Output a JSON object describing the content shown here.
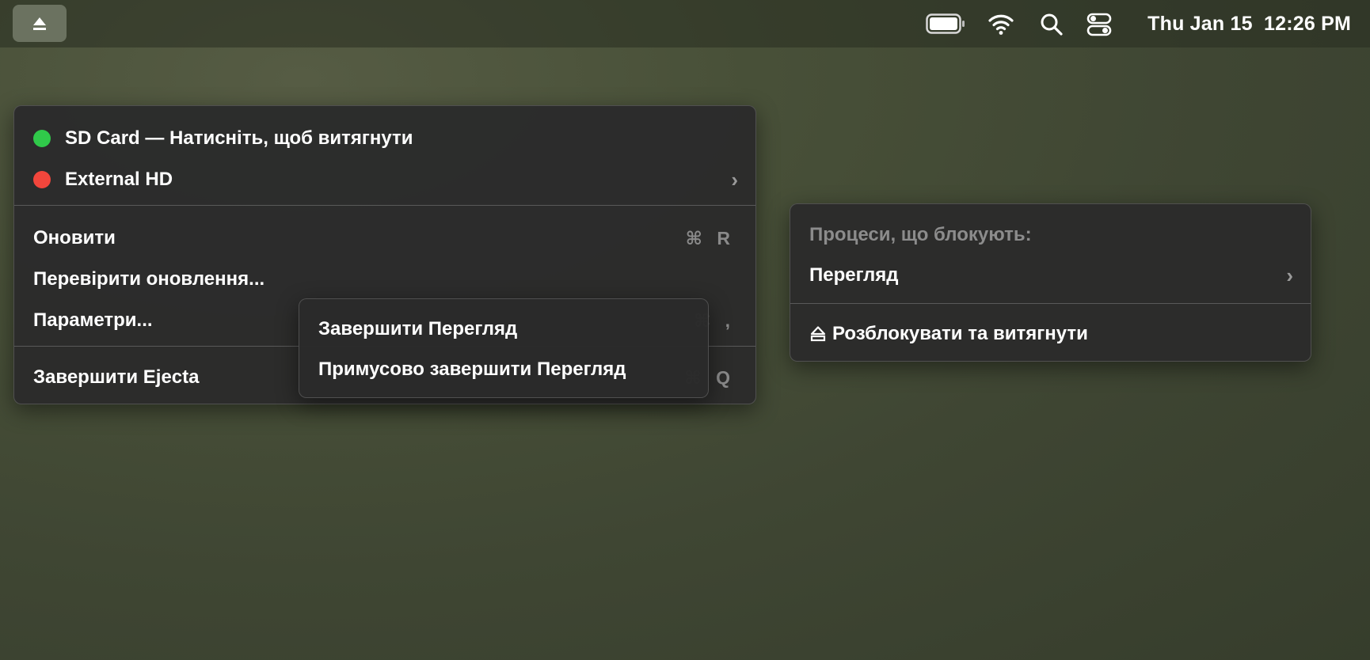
{
  "menubar": {
    "clock": "Thu Jan 15  12:26 PM",
    "icons": [
      "eject-icon",
      "battery-icon",
      "wifi-icon",
      "search-icon",
      "control-center-icon"
    ]
  },
  "main_menu": {
    "drives": [
      {
        "label": "SD Card — Натисніть, щоб витягнути",
        "status_color": "#30c94a"
      },
      {
        "label": "External HD",
        "status_color": "#f2463c",
        "has_submenu": true
      }
    ],
    "items": [
      {
        "label": "Оновити",
        "shortcut": "⌘ R"
      },
      {
        "label": "Перевірити оновлення..."
      },
      {
        "label": "Параметри...",
        "shortcut": "⌘ ,"
      },
      {
        "label": "Завершити Ejecta",
        "shortcut": "⌘ Q"
      }
    ]
  },
  "quit_popup": {
    "items": [
      {
        "label": "Завершити Перегляд"
      },
      {
        "label": "Примусово завершити Перегляд"
      }
    ]
  },
  "blocking_menu": {
    "header": "Процеси, що блокують:",
    "process": "Перегляд",
    "action": "Розблокувати та витягнути"
  }
}
